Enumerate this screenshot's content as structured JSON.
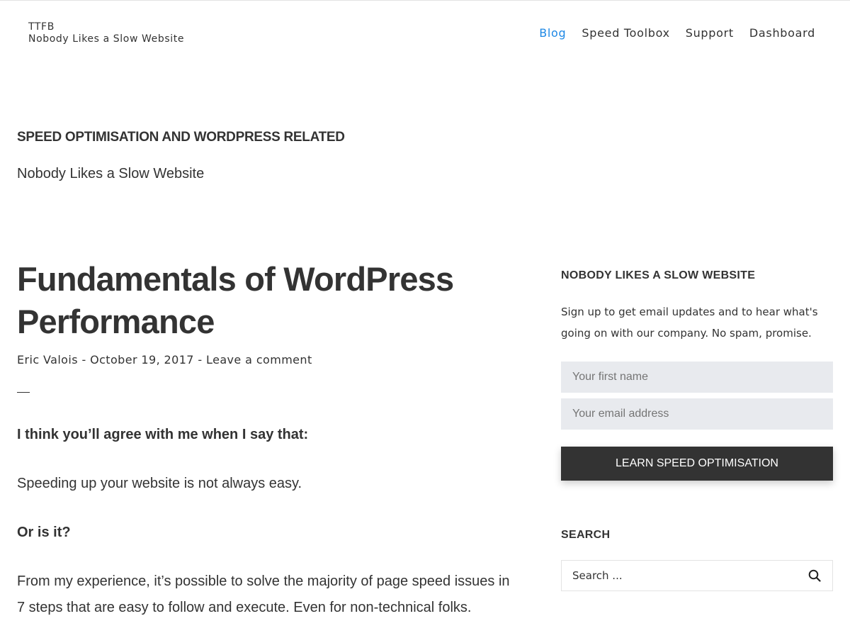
{
  "site": {
    "title": "TTFB",
    "tagline": "Nobody Likes a Slow Website"
  },
  "nav": {
    "items": [
      {
        "label": "Blog",
        "active": true
      },
      {
        "label": "Speed Toolbox",
        "active": false
      },
      {
        "label": "Support",
        "active": false
      },
      {
        "label": "Dashboard",
        "active": false
      }
    ]
  },
  "blog_header": {
    "heading": "SPEED OPTIMISATION AND WORDPRESS RELATED",
    "tagline": "Nobody Likes a Slow Website"
  },
  "post": {
    "title": "Fundamentals of WordPress Performance",
    "author": "Eric Valois",
    "date": "October 19, 2017",
    "comment_link": "Leave a comment",
    "meta_separator": " - ",
    "paragraphs": [
      "I think you’ll agree with me when I say that:",
      "Speeding up your website is not always easy.",
      "Or is it?",
      "From my experience, it’s possible to solve the majority of page speed issues in 7 steps that are easy to follow and execute. Even for non-technical folks."
    ]
  },
  "signup_widget": {
    "title": "NOBODY LIKES A SLOW WEBSITE",
    "text": "Sign up to get email updates and to hear what's going on with our company. No spam, promise.",
    "first_name_placeholder": "Your first name",
    "email_placeholder": "Your email address",
    "button_label": "LEARN SPEED OPTIMISATION"
  },
  "search_widget": {
    "title": "SEARCH",
    "placeholder": "Search ..."
  },
  "colors": {
    "accent": "#1e88e5",
    "text": "#333333",
    "button_bg": "#333333",
    "field_bg": "#e8eaee"
  }
}
